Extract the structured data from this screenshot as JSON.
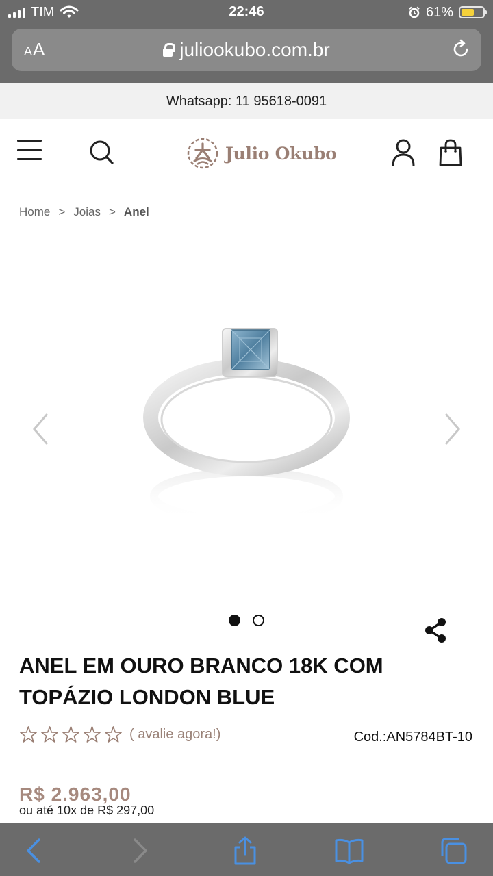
{
  "status_bar": {
    "carrier": "TIM",
    "time": "22:46",
    "battery_percent_label": "61%",
    "battery_level": 0.61
  },
  "browser": {
    "reader_label_small": "A",
    "reader_label_big": "A",
    "url": "juliookubo.com.br"
  },
  "site": {
    "promo_text": "Whatsapp: 11 95618-0091",
    "logo_text": "Julio Okubo",
    "brand_color": "#9a7f74",
    "price_color": "#a6897e"
  },
  "breadcrumb": [
    {
      "label": "Home"
    },
    {
      "label": ">"
    },
    {
      "label": "Joias"
    },
    {
      "label": ">"
    },
    {
      "label": "Anel"
    }
  ],
  "gallery": {
    "image_count": 2,
    "active_index": 0
  },
  "product": {
    "title_line1": "ANEL EM OURO BRANCO 18K COM",
    "title_line2": "TOPÁZIO LONDON BLUE",
    "rating_value": 0,
    "rating_max": 5,
    "rating_link": "( avalie agora!)",
    "code": "Cod.:AN5784BT-10",
    "price": "R$ 2.963,00",
    "installments": "ou até 10x de R$ 297,00"
  },
  "toolbar": {
    "items": [
      "back-icon",
      "forward-icon",
      "share-icon",
      "bookmarks-icon",
      "tabs-icon"
    ],
    "accent_color": "#4a90e2"
  }
}
